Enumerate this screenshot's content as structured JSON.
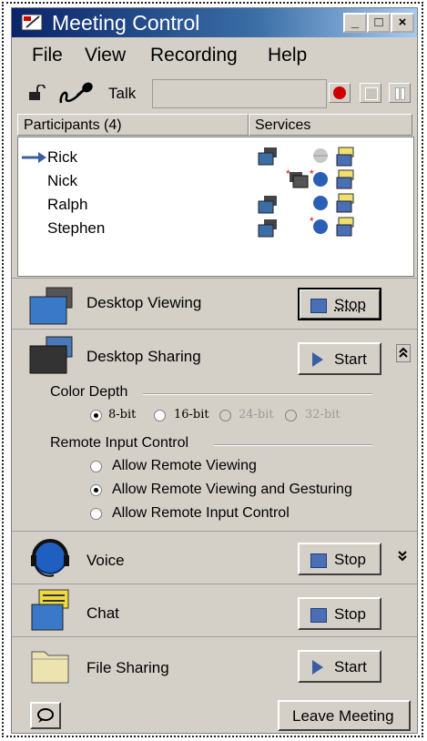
{
  "window": {
    "title": "Meeting Control",
    "minimize": "_",
    "maximize": "□",
    "close": "×"
  },
  "menu": [
    {
      "label": "File"
    },
    {
      "label": "View"
    },
    {
      "label": "Recording"
    },
    {
      "label": "Help"
    }
  ],
  "toolbar": {
    "talk_label": "Talk",
    "lock_icon": "padlock-icon",
    "mic_icon": "microphone-icon"
  },
  "participants_header": "Participants (4)",
  "services_header": "Services",
  "participants": [
    {
      "name": "Rick",
      "current": true
    },
    {
      "name": "Nick",
      "current": false
    },
    {
      "name": "Ralph",
      "current": false
    },
    {
      "name": "Stephen",
      "current": false
    }
  ],
  "sections": {
    "desktop_viewing": {
      "label": "Desktop Viewing",
      "button": "Stop"
    },
    "desktop_sharing": {
      "label": "Desktop Sharing",
      "button": "Start"
    },
    "voice": {
      "label": "Voice",
      "button": "Stop"
    },
    "chat": {
      "label": "Chat",
      "button": "Stop"
    },
    "file_sharing": {
      "label": "File Sharing",
      "button": "Start"
    }
  },
  "color_depth": {
    "label": "Color Depth",
    "options": [
      {
        "label": "8-bit",
        "selected": true,
        "enabled": true
      },
      {
        "label": "16-bit",
        "selected": false,
        "enabled": true
      },
      {
        "label": "24-bit",
        "selected": false,
        "enabled": false
      },
      {
        "label": "32-bit",
        "selected": false,
        "enabled": false
      }
    ]
  },
  "remote_input": {
    "label": "Remote Input Control",
    "options": [
      {
        "label": "Allow Remote Viewing",
        "selected": false
      },
      {
        "label": "Allow Remote Viewing and Gesturing",
        "selected": true
      },
      {
        "label": "Allow Remote Input Control",
        "selected": false
      }
    ]
  },
  "leave_button": "Leave Meeting",
  "colors": {
    "titlebar": "#0a246a",
    "window_bg": "#d4d0c8",
    "record": "#cc0000"
  }
}
